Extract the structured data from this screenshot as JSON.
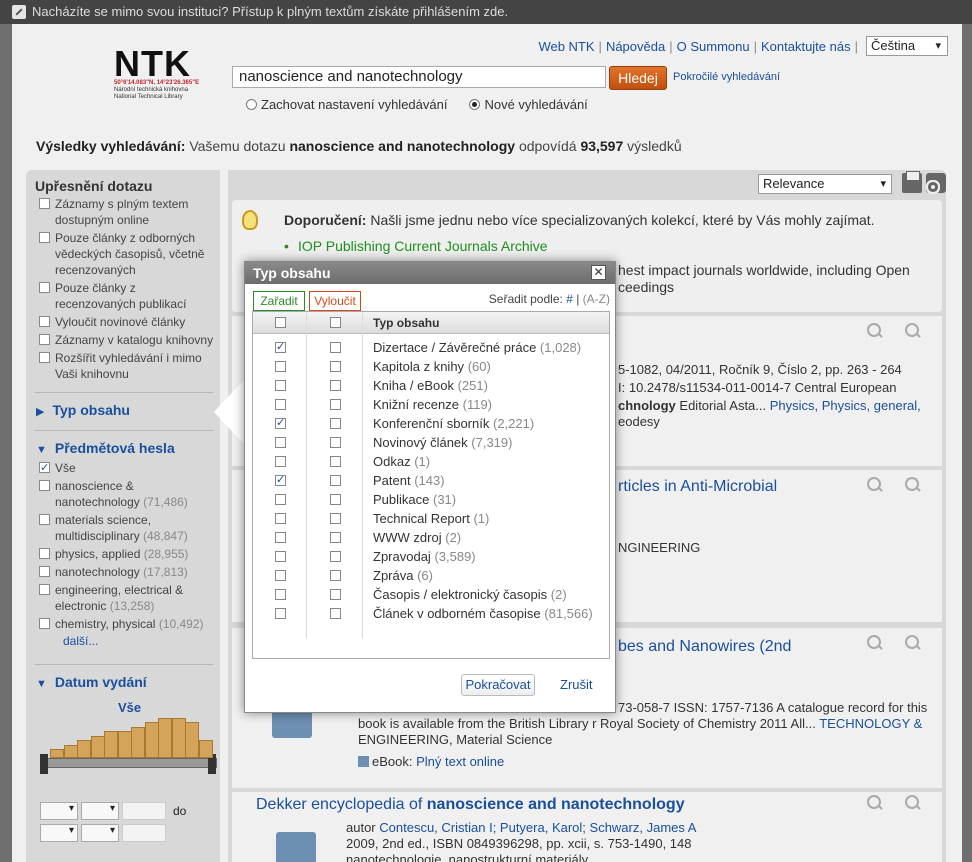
{
  "topbar": {
    "notice": "Nacházíte se mimo svou instituci? Přístup k plným textům získáte přihlášením zde."
  },
  "logo": {
    "text": "NTK",
    "coords": "50°6'14.083\"N, 14°23'26.365\"E",
    "line1": "Národní technická knihovna",
    "line2": "National Technical Library"
  },
  "nav": {
    "links": [
      "Web NTK",
      "Nápověda",
      "O Summonu",
      "Kontaktujte nás"
    ],
    "language": "Čeština"
  },
  "search": {
    "query": "nanoscience and nanotechnology",
    "button": "Hledej",
    "advanced": "Pokročilé vyhledávání",
    "opt_keep": "Zachovat nastavení vyhledávání",
    "opt_new": "Nové vyhledávání"
  },
  "results": {
    "label": "Výsledky vyhledávání:",
    "pre": "Vašemu dotazu",
    "query": "nanoscience and nanotechnology",
    "mid": "odpovídá",
    "count": "93,597",
    "post": "výsledků"
  },
  "sidebar": {
    "refine_title": "Upřesnění dotazu",
    "refine_items": [
      "Záznamy s plným textem dostupným online",
      "Pouze články z odborných vědeckých časopisů, včetně recenzovaných",
      "Pouze články z recenzovaných publikací",
      "Vyloučit novinové články",
      "Záznamy v katalogu knihovny",
      "Rozšířit vyhledávání i mimo Vaši knihovnu"
    ],
    "content_type": "Typ obsahu",
    "subjects_title": "Předmětová hesla",
    "subjects": [
      {
        "label": "Vše",
        "count": "",
        "checked": true
      },
      {
        "label": "nanoscience & nanotechnology",
        "count": "(71,486)"
      },
      {
        "label": "materials science, multidisciplinary",
        "count": "(48,847)"
      },
      {
        "label": "physics, applied",
        "count": "(28,955)"
      },
      {
        "label": "nanotechnology",
        "count": "(17,813)"
      },
      {
        "label": "engineering, electrical & electronic",
        "count": "(13,258)"
      },
      {
        "label": "chemistry, physical",
        "count": "(10,492)"
      }
    ],
    "more": "další...",
    "date_title": "Datum vydání",
    "date_all": "Vše",
    "histogram": [
      2,
      3,
      4,
      5,
      6,
      6,
      7,
      8,
      9,
      9,
      8,
      4
    ],
    "date_to": "do"
  },
  "main": {
    "sort": "Relevance",
    "rec_label": "Doporučení:",
    "rec_text": "Našli jsme jednu nebo více specializovaných kolekcí, které by Vás mohly zajímat.",
    "rec_link": "IOP Publishing Current Journals Archive",
    "rec_desc1": "hest impact journals worldwide, including Open",
    "rec_desc2": "ceedings",
    "r1_line1": "5-1082, 04/2011, Ročník 9, Číslo 2, pp. 263 - 264",
    "r1_line2": "I: 10.2478/s11534-011-0014-7 Central European",
    "r1_line3a": "chnology",
    "r1_line3b": "Editorial Asta...",
    "r1_tags": "Physics, Physics, general,",
    "r1_line4": "eodesy",
    "r2_title": "rticles in Anti-Microbial",
    "r2_tag": "NGINEERING",
    "r3_title": "bes and Nanowires (2nd",
    "r3_line1": "73-058-7 ISSN: 1757-7136 A catalogue record for this",
    "r3_line2a": "book is available from the British Library r Royal Society of Chemistry 2011 All...",
    "r3_line2b": "TECHNOLOGY &",
    "r3_line3": "ENGINEERING, Material Science",
    "r3_ebook": "eBook:",
    "r3_ebook_link": "Plný text online",
    "r4_title_a": "Dekker encyclopedia of",
    "r4_title_b": "nanoscience and nanotechnology",
    "r4_author_label": "autor",
    "r4_authors": "Contescu, Cristian I; Putyera, Karol; Schwarz, James A",
    "r4_pub": "2009, 2nd ed., ISBN 0849396298, pp. xcii, s. 753-1490, 148",
    "r4_tags": "nanotechnologie, nanostrukturní materiály"
  },
  "dialog": {
    "title": "Typ obsahu",
    "include": "Zařadit",
    "exclude": "Vyloučit",
    "sort_label": "Seřadit podle:",
    "sort_num": "#",
    "sort_az": "(A-Z)",
    "col_header": "Typ obsahu",
    "items": [
      {
        "label": "Dizertace / Závěrečné práce",
        "count": "(1,028)",
        "inc": true
      },
      {
        "label": "Kapitola z knihy",
        "count": "(60)",
        "inc": false
      },
      {
        "label": "Kniha / eBook",
        "count": "(251)",
        "inc": false
      },
      {
        "label": "Knižní recenze",
        "count": "(119)",
        "inc": false
      },
      {
        "label": "Konferenční sborník",
        "count": "(2,221)",
        "inc": true
      },
      {
        "label": "Novinový článek",
        "count": "(7,319)",
        "inc": false
      },
      {
        "label": "Odkaz",
        "count": "(1)",
        "inc": false
      },
      {
        "label": "Patent",
        "count": "(143)",
        "inc": true
      },
      {
        "label": "Publikace",
        "count": "(31)",
        "inc": false
      },
      {
        "label": "Technical Report",
        "count": "(1)",
        "inc": false
      },
      {
        "label": "WWW zdroj",
        "count": "(2)",
        "inc": false
      },
      {
        "label": "Zpravodaj",
        "count": "(3,589)",
        "inc": false
      },
      {
        "label": "Zpráva",
        "count": "(6)",
        "inc": false
      },
      {
        "label": "Časopis / elektronický časopis",
        "count": "(2)",
        "inc": false
      },
      {
        "label": "Článek v odborném časopise",
        "count": "(81,566)",
        "inc": false
      }
    ],
    "ok": "Pokračovat",
    "cancel": "Zrušit"
  }
}
